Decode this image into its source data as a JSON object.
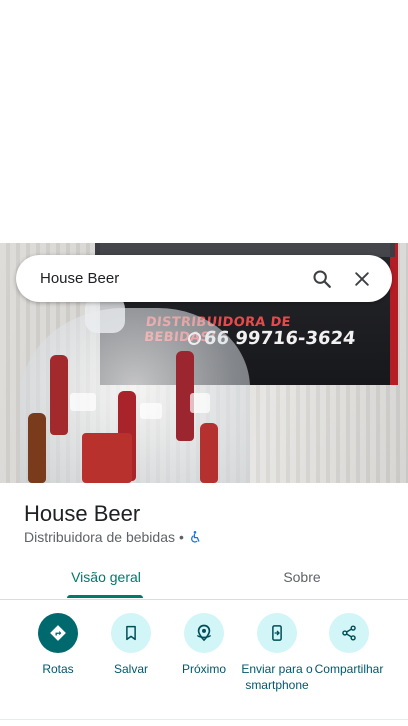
{
  "search": {
    "query": "House Beer",
    "search_icon": "search-icon",
    "close_icon": "close-icon"
  },
  "photo": {
    "sign_text": "DISTRIBUIDORA DE BEBIDAS!",
    "sign_phone": "66 99716-3624"
  },
  "place": {
    "name": "House Beer",
    "category": "Distribuidora de bebidas",
    "separator": "•",
    "accessibility_icon": "wheelchair-icon"
  },
  "tabs": [
    {
      "label": "Visão geral",
      "selected": true
    },
    {
      "label": "Sobre",
      "selected": false
    }
  ],
  "actions": [
    {
      "label": "Rotas",
      "icon": "directions-icon"
    },
    {
      "label": "Salvar",
      "icon": "bookmark-icon"
    },
    {
      "label": "Próximo",
      "icon": "nearby-icon"
    },
    {
      "label": "Enviar para o smartphone",
      "icon": "send-to-phone-icon"
    },
    {
      "label": "Compartilhar",
      "icon": "share-icon"
    }
  ],
  "colors": {
    "accent": "#00796b",
    "action_bg": "#d2f5f7",
    "primary_action_bg": "#00696d"
  }
}
